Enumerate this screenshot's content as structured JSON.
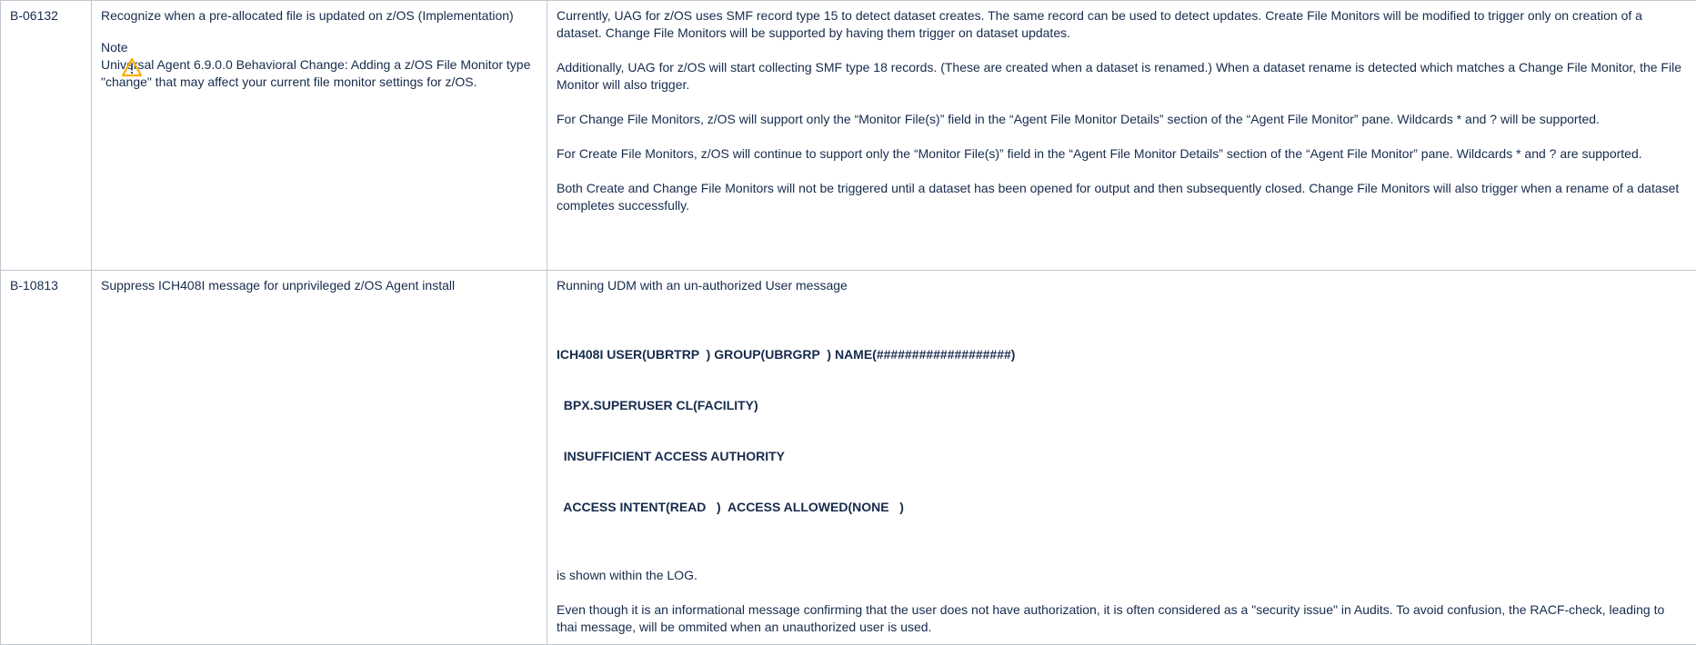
{
  "rows": [
    {
      "id": "B-06132",
      "title": "Recognize when a pre-allocated file is updated on z/OS (Implementation)",
      "note_label": "Note",
      "note_icon": "warning-icon",
      "note_text": "Universal Agent 6.9.0.0 Behavioral Change: Adding a z/OS File Monitor type \"change\" that may affect your current file monitor settings for z/OS.",
      "paragraphs": [
        "Currently, UAG for z/OS uses SMF record type 15 to detect dataset creates. The same record can be used to detect updates. Create File Monitors will be modified to trigger only on creation of a dataset. Change File Monitors will be supported by having them trigger on dataset updates.",
        "Additionally, UAG for z/OS will start collecting SMF type 18 records. (These are created when a dataset is renamed.) When a dataset rename is detected which matches a Change File Monitor, the File Monitor will also trigger.",
        "For Change File Monitors, z/OS will support only the “Monitor File(s)” field in the “Agent File Monitor Details” section of the “Agent File Monitor” pane. Wildcards * and ? will be supported.",
        "For Create File Monitors, z/OS will continue to support only the “Monitor File(s)” field in the “Agent File Monitor Details” section of the “Agent File Monitor” pane. Wildcards * and ? are supported.",
        "Both Create and Change File Monitors will not be triggered until a dataset has been opened for output and then subsequently closed. Change File Monitors will also trigger when a rename of a dataset completes successfully."
      ]
    },
    {
      "id": "B-10813",
      "title": "Suppress ICH408I message for unprivileged z/OS Agent install",
      "intro": "Running UDM with an un-authorized User message",
      "message_lines": [
        "ICH408I USER(UBRTRP  ) GROUP(UBRGRP  ) NAME(###################)",
        "  BPX.SUPERUSER CL(FACILITY)",
        "  INSUFFICIENT ACCESS AUTHORITY",
        "  ACCESS INTENT(READ   )  ACCESS ALLOWED(NONE   )"
      ],
      "after_message": "is shown within the LOG.",
      "closing": "Even though it is an informational message confirming that the user does not have authorization, it is often considered as a \"security issue\" in Audits. To avoid confusion, the RACF-check, leading to thai message, will be ommited when an unauthorized user is used."
    }
  ],
  "colors": {
    "border": "#c1c7d0",
    "text": "#172b4d",
    "warning_fill": "#ffab00"
  }
}
